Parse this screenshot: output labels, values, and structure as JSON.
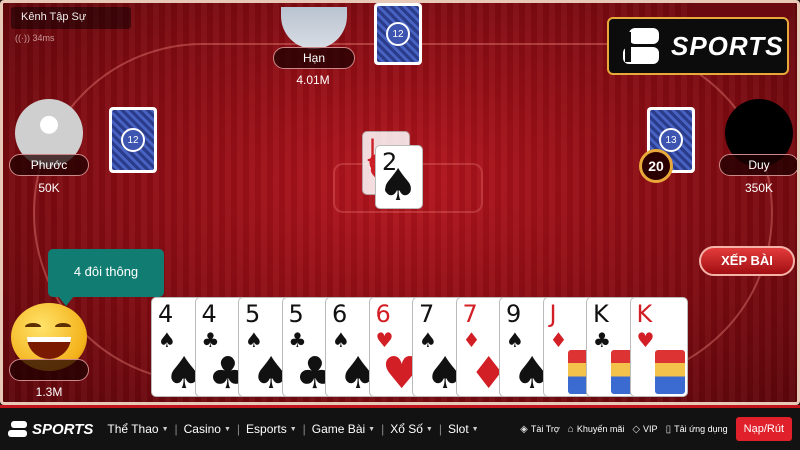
{
  "game": {
    "channel_label": "Kênh Tập Sự",
    "ping": "34ms",
    "timer": "20",
    "sort_button": "XẾP BÀI",
    "chat_bubble": "4 đôi thông"
  },
  "brand": {
    "name": "SPORTS",
    "accent": "#e8a93a"
  },
  "players": {
    "top": {
      "name": "Hạn",
      "chips": "4.01M",
      "cards_left": "12"
    },
    "left": {
      "name": "Phước",
      "chips": "50K",
      "cards_left": "12"
    },
    "right": {
      "name": "Duy",
      "chips": "350K",
      "cards_left": "13"
    },
    "self": {
      "chips": "1.3M"
    }
  },
  "played_cards": [
    {
      "rank": "J",
      "suit": "♥",
      "color": "red"
    },
    {
      "rank": "2",
      "suit": "♠",
      "color": "black"
    }
  ],
  "hand": [
    {
      "rank": "4",
      "suit": "♠",
      "color": "black"
    },
    {
      "rank": "4",
      "suit": "♣",
      "color": "black"
    },
    {
      "rank": "5",
      "suit": "♠",
      "color": "black"
    },
    {
      "rank": "5",
      "suit": "♣",
      "color": "black"
    },
    {
      "rank": "6",
      "suit": "♠",
      "color": "black"
    },
    {
      "rank": "6",
      "suit": "♥",
      "color": "red"
    },
    {
      "rank": "7",
      "suit": "♠",
      "color": "black"
    },
    {
      "rank": "7",
      "suit": "♦",
      "color": "red"
    },
    {
      "rank": "9",
      "suit": "♠",
      "color": "black"
    },
    {
      "rank": "J",
      "suit": "♦",
      "color": "red",
      "face": true
    },
    {
      "rank": "K",
      "suit": "♣",
      "color": "black",
      "face": true
    },
    {
      "rank": "K",
      "suit": "♥",
      "color": "red",
      "face": true
    }
  ],
  "nav": {
    "logo": "SPORTS",
    "menu": [
      "Thể Thao",
      "Casino",
      "Esports",
      "Game Bài",
      "Xổ Số",
      "Slot"
    ],
    "links": [
      {
        "label": "Tài Trợ",
        "icon": "shield-icon"
      },
      {
        "label": "Khuyến mãi",
        "icon": "tag-icon"
      },
      {
        "label": "VIP",
        "icon": "diamond-icon"
      },
      {
        "label": "Tải ứng dụng",
        "icon": "phone-icon"
      }
    ],
    "deposit": "Nạp/Rút"
  }
}
